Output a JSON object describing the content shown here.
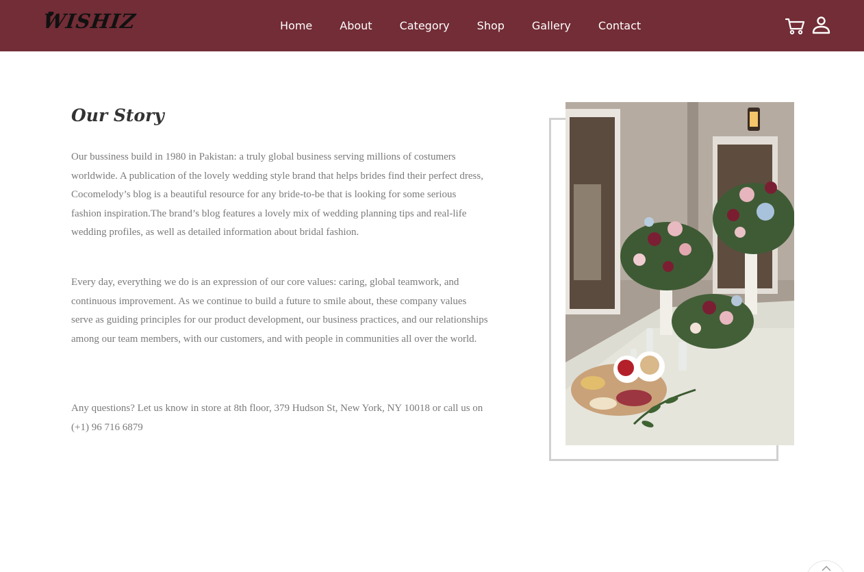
{
  "brand": {
    "logo_text": "WISHIZ",
    "nav_bg": "#722d36"
  },
  "nav": {
    "items": [
      {
        "label": "Home"
      },
      {
        "label": "About"
      },
      {
        "label": "Category"
      },
      {
        "label": "Shop"
      },
      {
        "label": "Gallery"
      },
      {
        "label": "Contact"
      }
    ],
    "icons": [
      "cart-icon",
      "user-icon"
    ]
  },
  "story": {
    "title": "Our Story",
    "paragraphs": [
      "Our bussiness build in 1980 in Pakistan: a truly global business serving millions of costumers worldwide. A publication of the lovely wedding style brand that helps brides find their perfect dress, Cocomelody’s blog is a beautiful resource for any bride-to-be that is looking for some serious fashion inspiration.The brand’s blog features a lovely mix of wedding planning tips and real-life wedding profiles, as well as detailed information about bridal fashion.",
      "Every day, everything we do is an expression of our core values: caring, global teamwork, and continuous improvement. As we continue to build a future to smile about, these company values serve as guiding principles for our product development, our business practices, and our relationships among our team members, with our customers, and with people in communities all over the world.",
      "Any questions? Let us know in store at 8th floor, 379 Hudson St, New York, NY 10018 or call us on (+1) 96 716 6879"
    ]
  },
  "image": {
    "subject": "wedding table floral centerpiece"
  },
  "scroll_top": {
    "icon": "arrow-up-icon"
  }
}
